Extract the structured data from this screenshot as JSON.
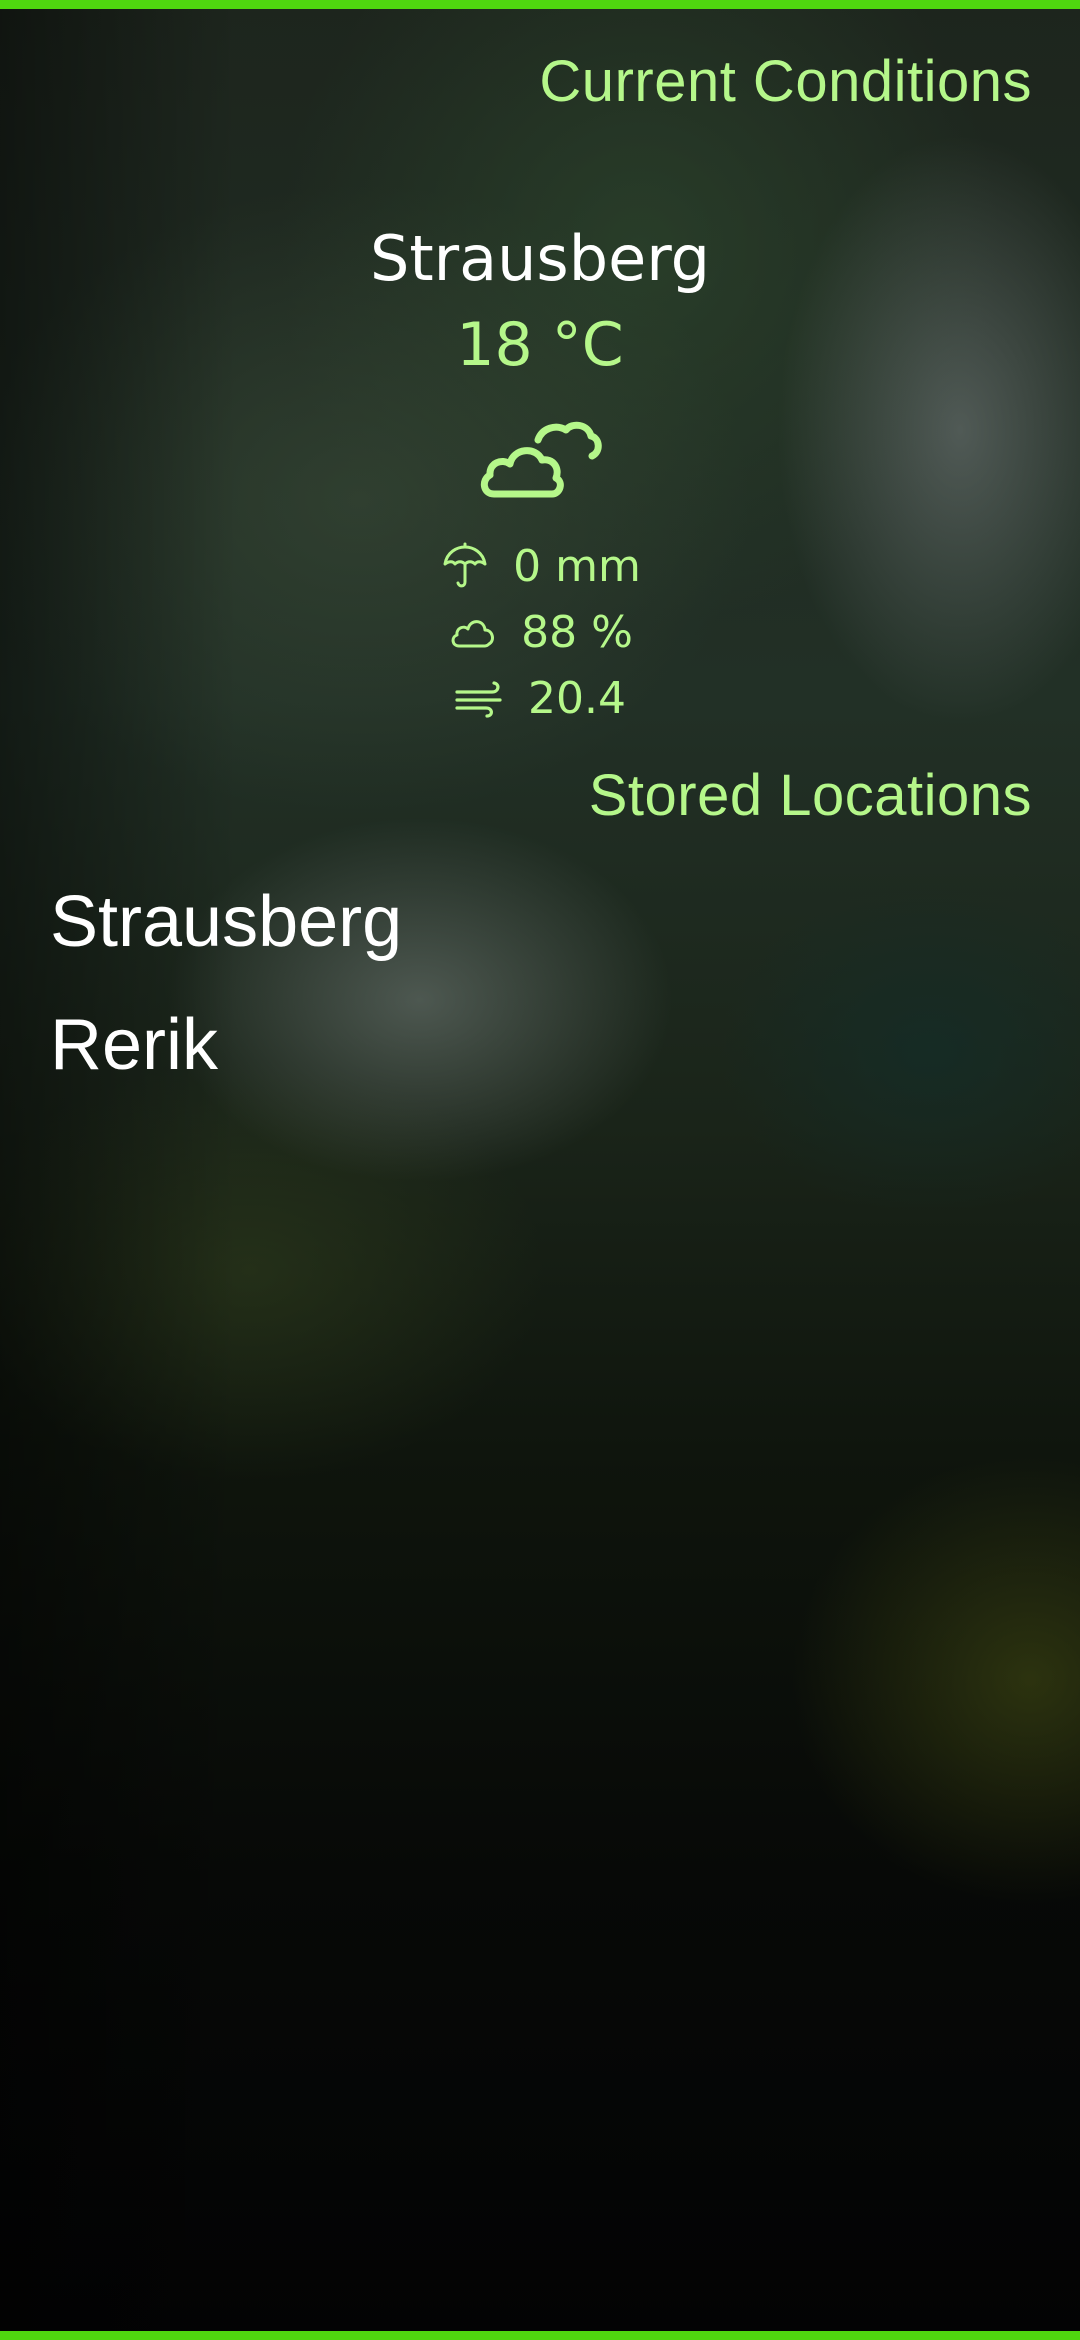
{
  "current": {
    "section_title": "Current Conditions",
    "city": "Strausberg",
    "temperature": "18 °C",
    "condition_icon": "partly-cloudy-icon",
    "precipitation": "0 mm",
    "precipitation_icon": "umbrella-icon",
    "cloud_cover": "88 %",
    "cloud_cover_icon": "cloud-icon",
    "wind": "20.4",
    "wind_icon": "wind-icon"
  },
  "stored": {
    "section_title": "Stored Locations",
    "locations": [
      {
        "name": "Strausberg"
      },
      {
        "name": "Rerik"
      }
    ]
  },
  "colors": {
    "accent": "#4fd70f",
    "highlight": "#b5f78a",
    "primary_text": "#ffffff"
  }
}
